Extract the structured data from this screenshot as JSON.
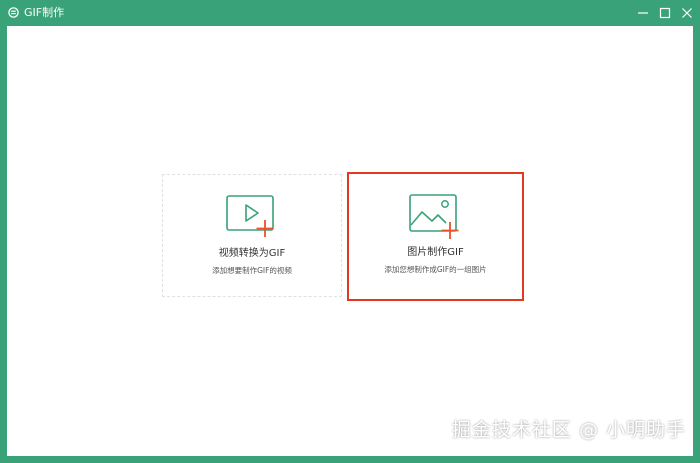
{
  "window": {
    "title": "GIF制作",
    "accent_color": "#3aa278",
    "controls": [
      "minimize-icon",
      "maximize-icon",
      "close-icon"
    ]
  },
  "cards": {
    "video": {
      "title": "视频转换为GIF",
      "description": "添加想要制作GIF的视频",
      "icon": "video-add-icon"
    },
    "image": {
      "title": "图片制作GIF",
      "description": "添加您想制作成GIF的一组图片",
      "icon": "image-add-icon",
      "highlight_color": "#e03b1e"
    }
  },
  "watermark": "掘金技术社区 @ 小明助手"
}
